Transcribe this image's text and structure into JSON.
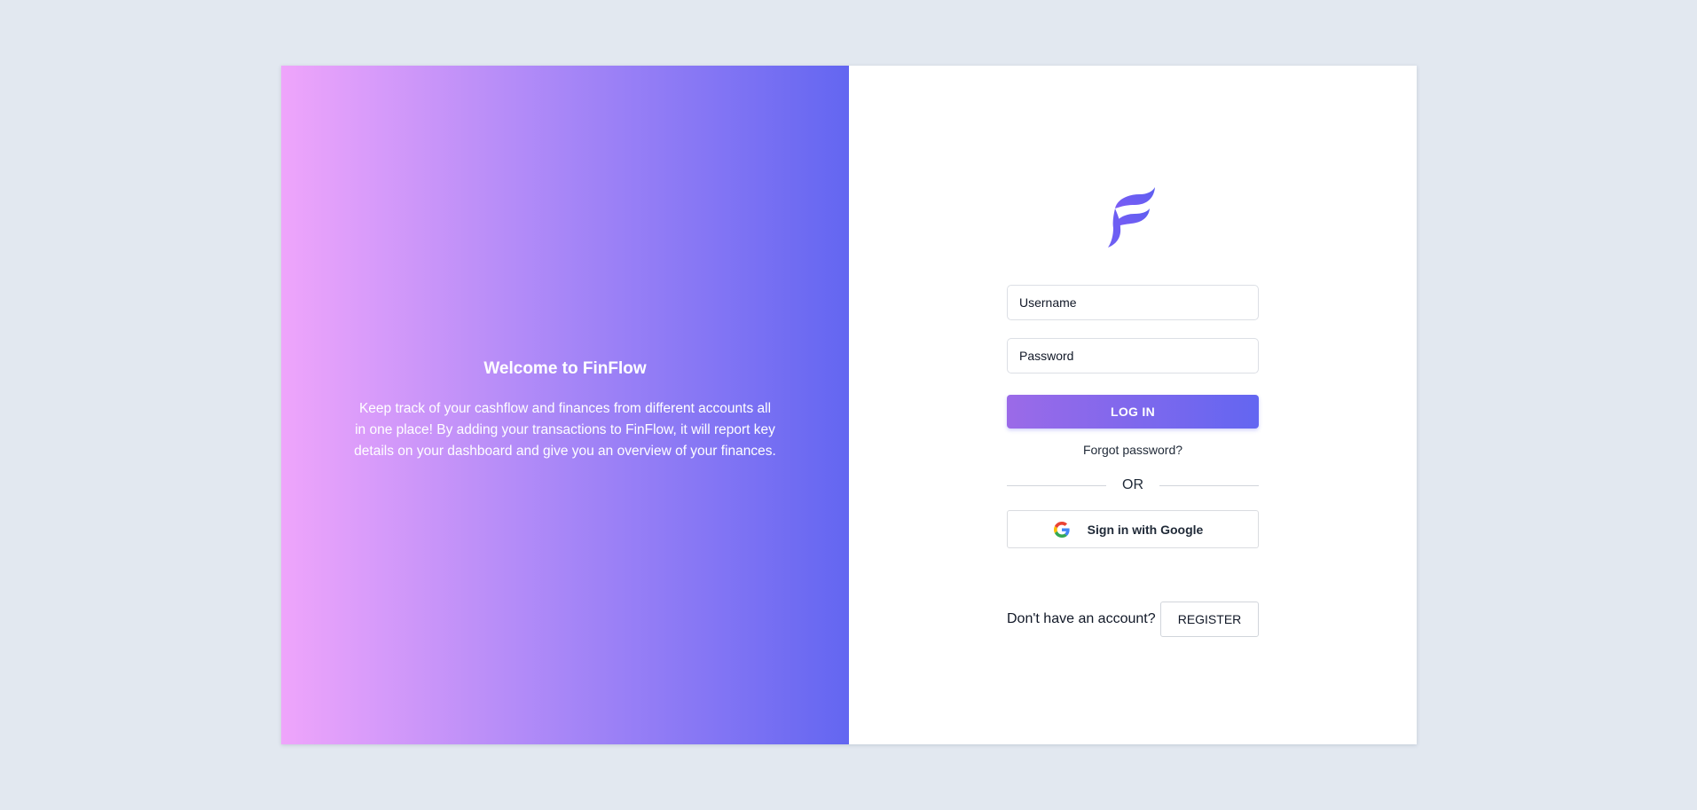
{
  "hero": {
    "title": "Welcome to FinFlow",
    "description": "Keep track of your cashflow and finances from different accounts all in one place! By adding your transactions to FinFlow, it will report key details on your dashboard and give you an overview of your finances."
  },
  "login": {
    "logo_icon": "finflow-logo-icon",
    "username_placeholder": "Username",
    "password_placeholder": "Password",
    "login_label": "LOG IN",
    "forgot_label": "Forgot password?",
    "divider_label": "OR",
    "google_icon": "google-icon",
    "google_label": "Sign in with Google",
    "register_prompt": "Don't have an account?",
    "register_label": "REGISTER"
  },
  "colors": {
    "background": "#e2e8f0",
    "gradient_start": "#efa5fb",
    "gradient_end": "#6366f1",
    "accent": "#6366f1"
  }
}
